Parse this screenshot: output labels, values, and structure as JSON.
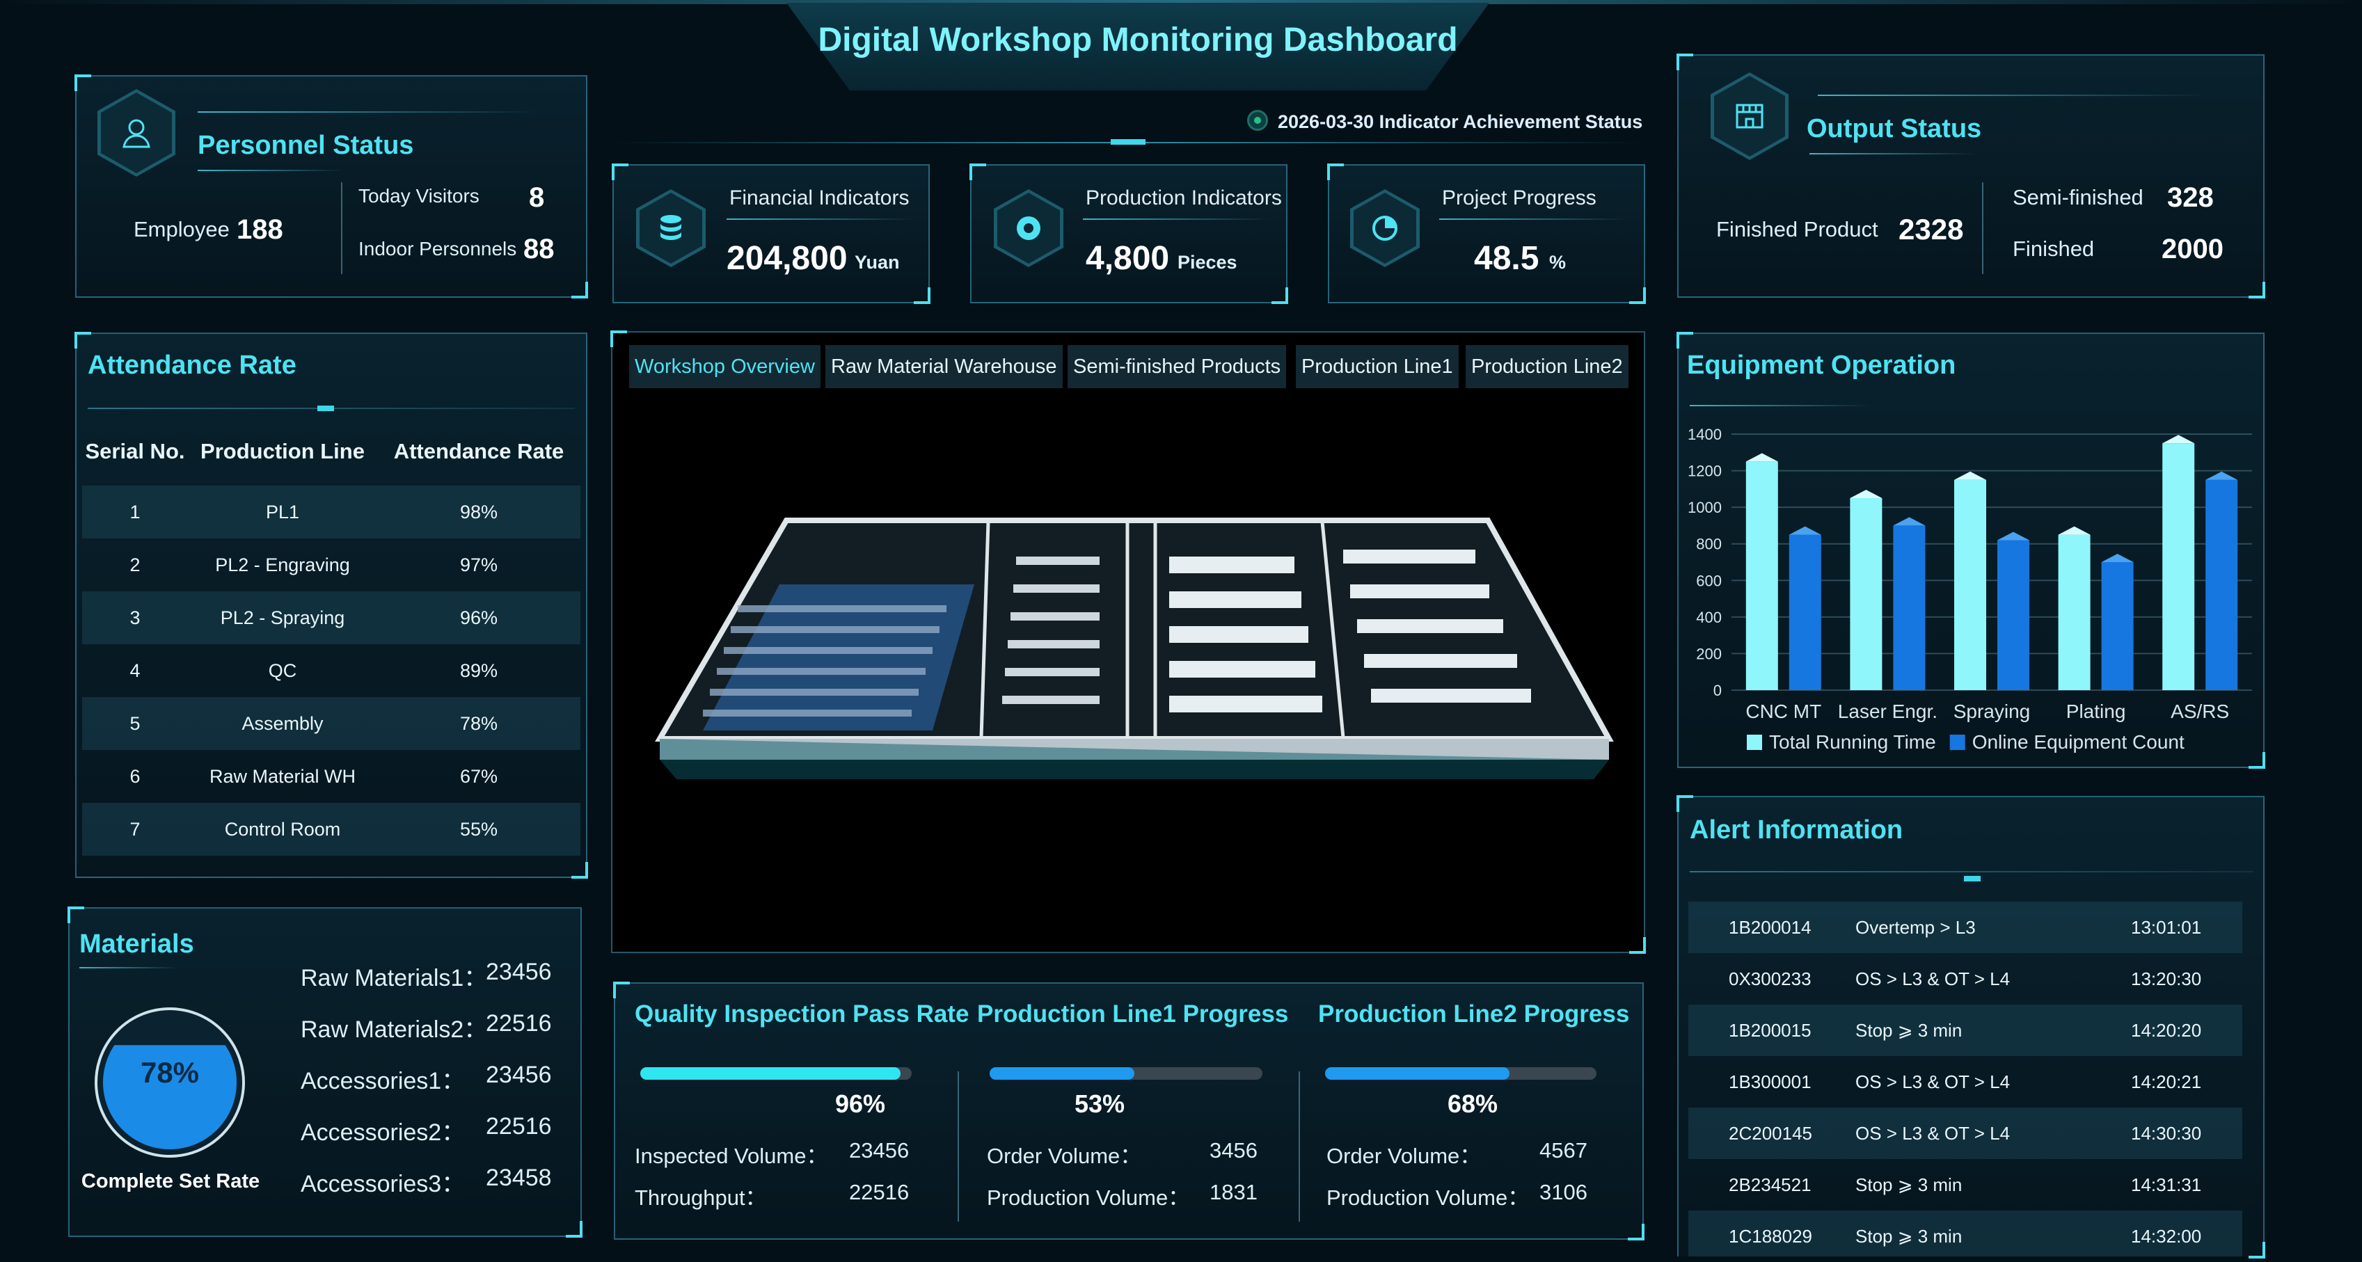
{
  "header": {
    "title": "Digital Workshop Monitoring Dashboard",
    "indicator_status": "2026-03-30 Indicator Achievement Status"
  },
  "personnel": {
    "title": "Personnel Status",
    "icon": "user-icon",
    "employee_label": "Employee",
    "employee_value": "188",
    "visitors_label": "Today Visitors",
    "visitors_value": "8",
    "indoor_label": "Indoor Personnels",
    "indoor_value": "88"
  },
  "indicators": [
    {
      "label": "Financial Indicators",
      "value": "204,800",
      "unit": "Yuan",
      "icon": "database-icon"
    },
    {
      "label": "Production Indicators",
      "value": "4,800",
      "unit": "Pieces",
      "icon": "disc-icon"
    },
    {
      "label": "Project Progress",
      "value": "48.5",
      "unit": "%",
      "icon": "pie-icon"
    }
  ],
  "output": {
    "title": "Output Status",
    "icon": "store-icon",
    "finished_product_label": "Finished Product",
    "finished_product_value": "2328",
    "semi_label": "Semi-finished",
    "semi_value": "328",
    "finished_label": "Finished",
    "finished_value": "2000"
  },
  "attendance": {
    "title": "Attendance Rate",
    "columns": [
      "Serial No.",
      "Production Line",
      "Attendance Rate"
    ],
    "rows": [
      [
        "1",
        "PL1",
        "98%"
      ],
      [
        "2",
        "PL2 - Engraving",
        "97%"
      ],
      [
        "3",
        "PL2 - Spraying",
        "96%"
      ],
      [
        "4",
        "QC",
        "89%"
      ],
      [
        "5",
        "Assembly",
        "78%"
      ],
      [
        "6",
        "Raw Material WH",
        "67%"
      ],
      [
        "7",
        "Control Room",
        "55%"
      ]
    ]
  },
  "tabs": [
    "Workshop Overview",
    "Raw Material Warehouse",
    "Semi-finished Products",
    "Production Line1",
    "Production Line2"
  ],
  "equipment": {
    "title": "Equipment Operation"
  },
  "chart_data": {
    "type": "bar",
    "categories": [
      "CNC MT",
      "Laser Engr.",
      "Spraying",
      "Plating",
      "AS/RS"
    ],
    "series": [
      {
        "name": "Total Running Time",
        "values": [
          1250,
          1050,
          1150,
          850,
          1350
        ],
        "color": "#8ff6fb"
      },
      {
        "name": "Online Equipment Count",
        "values": [
          850,
          900,
          820,
          700,
          1150
        ],
        "color": "#1677e0"
      }
    ],
    "ylim": [
      0,
      1400
    ],
    "yticks": [
      0,
      200,
      400,
      600,
      800,
      1000,
      1200,
      1400
    ],
    "grid": true,
    "legend": "bottom"
  },
  "materials": {
    "title": "Materials",
    "rate": "78%",
    "rate_value": 0.78,
    "rate_label": "Complete Set Rate",
    "items": [
      {
        "label": "Raw Materials1：",
        "value": "23456"
      },
      {
        "label": "Raw Materials2：",
        "value": "22516"
      },
      {
        "label": "Accessories1：",
        "value": "23456"
      },
      {
        "label": "Accessories2：",
        "value": "22516"
      },
      {
        "label": "Accessories3：",
        "value": "23458"
      }
    ]
  },
  "progress": [
    {
      "title": "Quality Inspection Pass Rate",
      "pct": "96%",
      "fraction": 0.96,
      "color": "#2ee6f0",
      "l1": "Inspected Volume：",
      "v1": "23456",
      "l2": "Throughput：",
      "v2": "22516"
    },
    {
      "title": "Production Line1 Progress",
      "pct": "53%",
      "fraction": 0.53,
      "color": "#1e9af0",
      "l1": "Order Volume：",
      "v1": "3456",
      "l2": "Production Volume：",
      "v2": "1831"
    },
    {
      "title": "Production Line2 Progress",
      "pct": "68%",
      "fraction": 0.68,
      "color": "#1e9af0",
      "l1": "Order Volume：",
      "v1": "4567",
      "l2": "Production Volume：",
      "v2": "3106"
    }
  ],
  "alerts": {
    "title": "Alert Information",
    "rows": [
      [
        "1B200014",
        "Overtemp > L3",
        "13:01:01"
      ],
      [
        "0X300233",
        "OS > L3 & OT > L4",
        "13:20:30"
      ],
      [
        "1B200015",
        "Stop ⩾ 3 min",
        "14:20:20"
      ],
      [
        "1B300001",
        "OS > L3 & OT > L4",
        "14:20:21"
      ],
      [
        "2C200145",
        "OS > L3 & OT > L4",
        "14:30:30"
      ],
      [
        "2B234521",
        "Stop ⩾ 3 min",
        "14:31:31"
      ],
      [
        "1C188029",
        "Stop ⩾ 3 min",
        "14:32:00"
      ]
    ]
  }
}
